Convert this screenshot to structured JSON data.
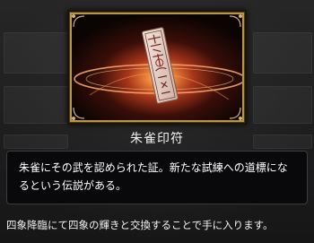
{
  "item": {
    "name": "朱雀印符",
    "icon": "vermilion-bird-seal-charm",
    "description": "朱雀にその武を認められた証。新たな試練への道標になるという伝説がある。",
    "acquisition": "四象降臨にて四象の輝きと交換することで手に入ります。"
  },
  "colors": {
    "frame_gold": "#b8954a",
    "background": "#1c1c1c",
    "description_panel": "#08080a",
    "text": "#ffffff"
  }
}
